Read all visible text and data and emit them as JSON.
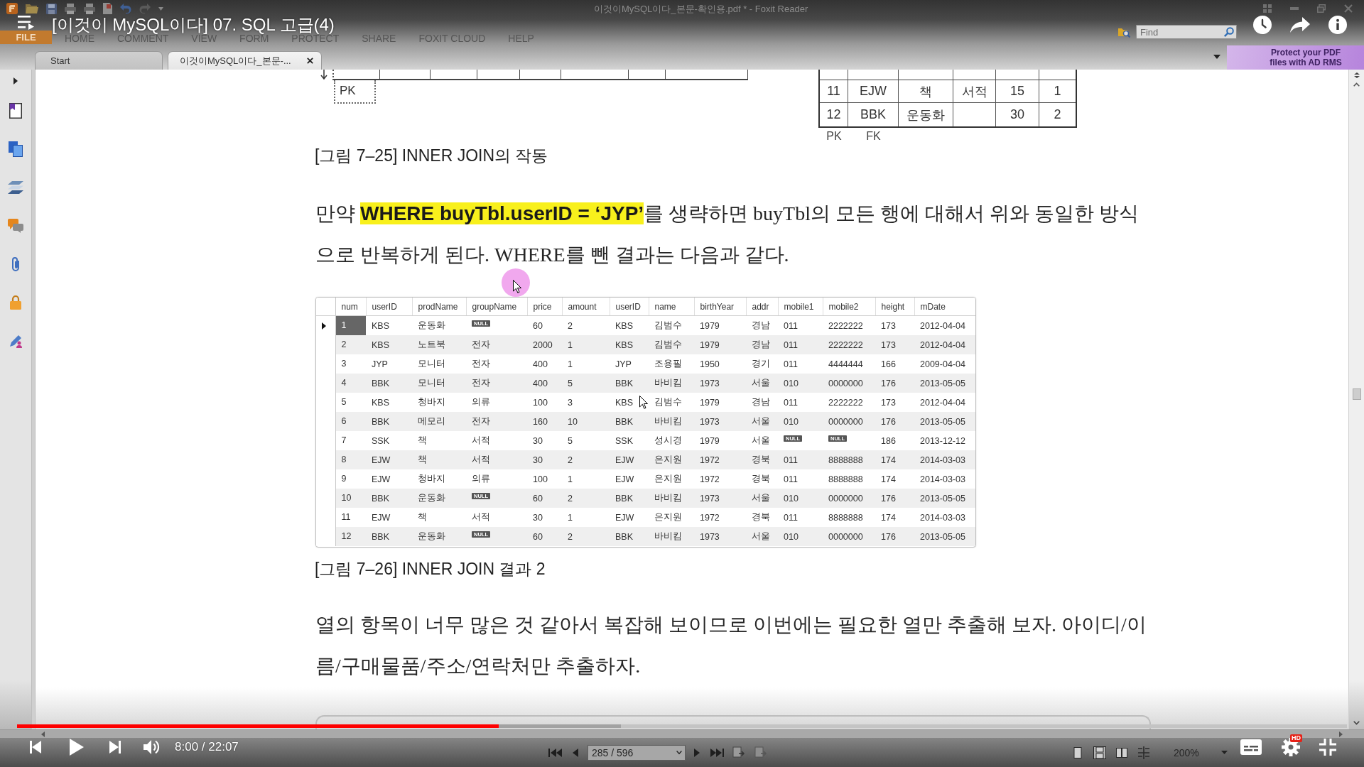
{
  "video": {
    "title": "[이것이 MySQL이다] 07. SQL 고급(4)",
    "playing": false,
    "time": "8:00 / 22:07",
    "progress": {
      "level": 0.362
    },
    "buffered": {
      "level": 0.454
    },
    "quality_badge": "HD"
  },
  "window": {
    "title": "이것이MySQL이다_본문-확인용.pdf * - Foxit Reader"
  },
  "ribbon": {
    "tabs": [
      {
        "label": "FILE",
        "kind": "menu"
      },
      {
        "label": "HOME",
        "kind": "tab"
      },
      {
        "label": "COMMENT",
        "kind": "tab"
      },
      {
        "label": "VIEW",
        "kind": "tab"
      },
      {
        "label": "FORM",
        "kind": "tab"
      },
      {
        "label": "PROTECT",
        "kind": "tab"
      },
      {
        "label": "SHARE",
        "kind": "tab"
      },
      {
        "label": "FOXIT CLOUD",
        "kind": "tab"
      },
      {
        "label": "HELP",
        "kind": "tab"
      }
    ],
    "search": {
      "placeholder": "Find"
    }
  },
  "doc_tabs": [
    {
      "label": "Start",
      "selected": false,
      "closable": false
    },
    {
      "label": "이것이MySQL이다_본문-...",
      "selected": true,
      "closable": true
    }
  ],
  "ad_banner": "Protect your PDF files with AD RMS",
  "document": {
    "figure_left": {
      "key_label": "PK"
    },
    "figure_right": {
      "rows": [
        [
          "11",
          "EJW",
          "책",
          "서적",
          "15",
          "1"
        ],
        [
          "12",
          "BBK",
          "운동화",
          null,
          "30",
          "2"
        ]
      ],
      "key_labels": [
        "PK",
        "FK"
      ]
    },
    "caption_1": "[그림 7–25] INNER JOIN의 작동",
    "paragraph_1": "만약 **WHERE buyTbl.userID = ‘JYP’**를 생략하면 buyTbl의 모든 행에 대해서 위와 동일한 방식으로 반복하게 된다. WHERE를 뺀 결과는 다음과 같다.",
    "result_grid": {
      "columns": [
        "num",
        "userID",
        "prodName",
        "groupName",
        "price",
        "amount",
        "userID",
        "name",
        "birthYear",
        "addr",
        "mobile1",
        "mobile2",
        "height",
        "mDate"
      ],
      "rows": [
        {
          "selected": true,
          "cells": [
            "1",
            "KBS",
            "운동화",
            {
              "text": "NULL",
              "kind": "null"
            },
            "60",
            "2",
            "KBS",
            "김범수",
            "1979",
            "경남",
            "011",
            "2222222",
            "173",
            "2012-04-04"
          ]
        },
        {
          "selected": false,
          "cells": [
            "2",
            "KBS",
            "노트북",
            "전자",
            "2000",
            "1",
            "KBS",
            "김범수",
            "1979",
            "경남",
            "011",
            "2222222",
            "173",
            "2012-04-04"
          ]
        },
        {
          "selected": false,
          "cells": [
            "3",
            "JYP",
            "모니터",
            "전자",
            "400",
            "1",
            "JYP",
            "조용필",
            "1950",
            "경기",
            "011",
            "4444444",
            "166",
            "2009-04-04"
          ]
        },
        {
          "selected": false,
          "cells": [
            "4",
            "BBK",
            "모니터",
            "전자",
            "400",
            "5",
            "BBK",
            "바비킴",
            "1973",
            "서울",
            "010",
            "0000000",
            "176",
            "2013-05-05"
          ]
        },
        {
          "selected": false,
          "cells": [
            "5",
            "KBS",
            "청바지",
            "의류",
            "100",
            "3",
            "KBS",
            "김범수",
            "1979",
            "경남",
            "011",
            "2222222",
            "173",
            "2012-04-04"
          ]
        },
        {
          "selected": false,
          "cells": [
            "6",
            "BBK",
            "메모리",
            "전자",
            "160",
            "10",
            "BBK",
            "바비킴",
            "1973",
            "서울",
            "010",
            "0000000",
            "176",
            "2013-05-05"
          ]
        },
        {
          "selected": false,
          "cells": [
            "7",
            "SSK",
            "책",
            "서적",
            "30",
            "5",
            "SSK",
            "성시경",
            "1979",
            "서울",
            {
              "text": "NULL",
              "kind": "null"
            },
            {
              "text": "NULL",
              "kind": "null"
            },
            "186",
            "2013-12-12"
          ]
        },
        {
          "selected": false,
          "cells": [
            "8",
            "EJW",
            "책",
            "서적",
            "30",
            "2",
            "EJW",
            "은지원",
            "1972",
            "경북",
            "011",
            "8888888",
            "174",
            "2014-03-03"
          ]
        },
        {
          "selected": false,
          "cells": [
            "9",
            "EJW",
            "청바지",
            "의류",
            "100",
            "1",
            "EJW",
            "은지원",
            "1972",
            "경북",
            "011",
            "8888888",
            "174",
            "2014-03-03"
          ]
        },
        {
          "selected": false,
          "cells": [
            "10",
            "BBK",
            "운동화",
            {
              "text": "NULL",
              "kind": "null"
            },
            "60",
            "2",
            "BBK",
            "바비킴",
            "1973",
            "서울",
            "010",
            "0000000",
            "176",
            "2013-05-05"
          ]
        },
        {
          "selected": false,
          "cells": [
            "11",
            "EJW",
            "책",
            "서적",
            "30",
            "1",
            "EJW",
            "은지원",
            "1972",
            "경북",
            "011",
            "8888888",
            "174",
            "2014-03-03"
          ]
        },
        {
          "selected": false,
          "cells": [
            "12",
            "BBK",
            "운동화",
            {
              "text": "NULL",
              "kind": "null"
            },
            "60",
            "2",
            "BBK",
            "바비킴",
            "1973",
            "서울",
            "010",
            "0000000",
            "176",
            "2013-05-05"
          ]
        }
      ]
    },
    "caption_2": "[그림 7–26] INNER JOIN 결과 2",
    "paragraph_2": "열의 항목이 너무 많은 것 같아서 복잡해 보이므로 이번에는 필요한 열만 추출해 보자. 아이디/이름/구매물품/주소/연락처만 추출하자."
  },
  "status_bar": {
    "page": "285 / 596",
    "view_modes": [
      {
        "selected": false
      },
      {
        "selected": true
      },
      {
        "selected": false
      },
      {
        "selected": false
      }
    ],
    "zoom": "200%"
  }
}
